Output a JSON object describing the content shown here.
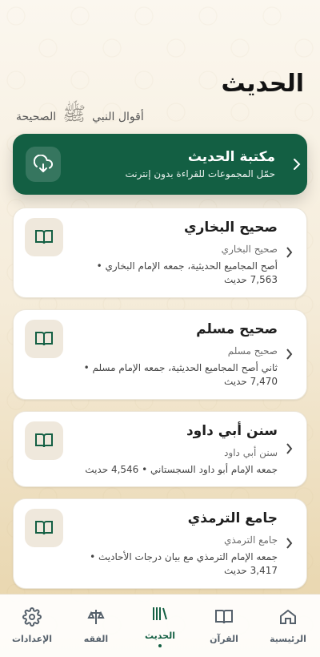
{
  "header": {
    "title": "الحديث",
    "subtitle": "أقوال النبي",
    "honorific": "ﷺ",
    "subtitle_end": "الصحيحة"
  },
  "library": {
    "title": "مكتبة الحديث",
    "description": "حمّل المجموعات للقراءة بدون إنترنت",
    "download_icon": "cloud-download-icon",
    "chevron_icon": "chevron-right-icon"
  },
  "books": [
    {
      "name": "صحيح البخاري",
      "subtitle": "صحيح البخاري",
      "description": "أصح المجاميع الحديثية، جمعه الإمام البخاري • 7,563 حديث",
      "icon": "book-icon"
    },
    {
      "name": "صحيح مسلم",
      "subtitle": "صحيح مسلم",
      "description": "ثاني أصح المجاميع الحديثية، جمعه الإمام مسلم • 7,470 حديث",
      "icon": "book-icon"
    },
    {
      "name": "سنن أبي داود",
      "subtitle": "سنن أبي داود",
      "description": "جمعه الإمام أبو داود السجستاني • 4,546 حديث",
      "icon": "book-icon"
    },
    {
      "name": "جامع الترمذي",
      "subtitle": "جامع الترمذي",
      "description": "جمعه الإمام الترمذي مع بيان درجات الأحاديث • 3,417 حديث",
      "icon": "book-icon"
    }
  ],
  "bottom_nav": [
    {
      "label": "الرئيسية",
      "icon": "home-icon",
      "active": false
    },
    {
      "label": "القرآن",
      "icon": "quran-icon",
      "active": false
    },
    {
      "label": "الحديث",
      "icon": "library-icon",
      "active": true
    },
    {
      "label": "الفقه",
      "icon": "scale-icon",
      "active": false
    },
    {
      "label": "الإعدادات",
      "icon": "gear-icon",
      "active": false
    }
  ],
  "colors": {
    "primary": "#135f43",
    "background": "#f7efdf",
    "card": "#ffffff"
  }
}
